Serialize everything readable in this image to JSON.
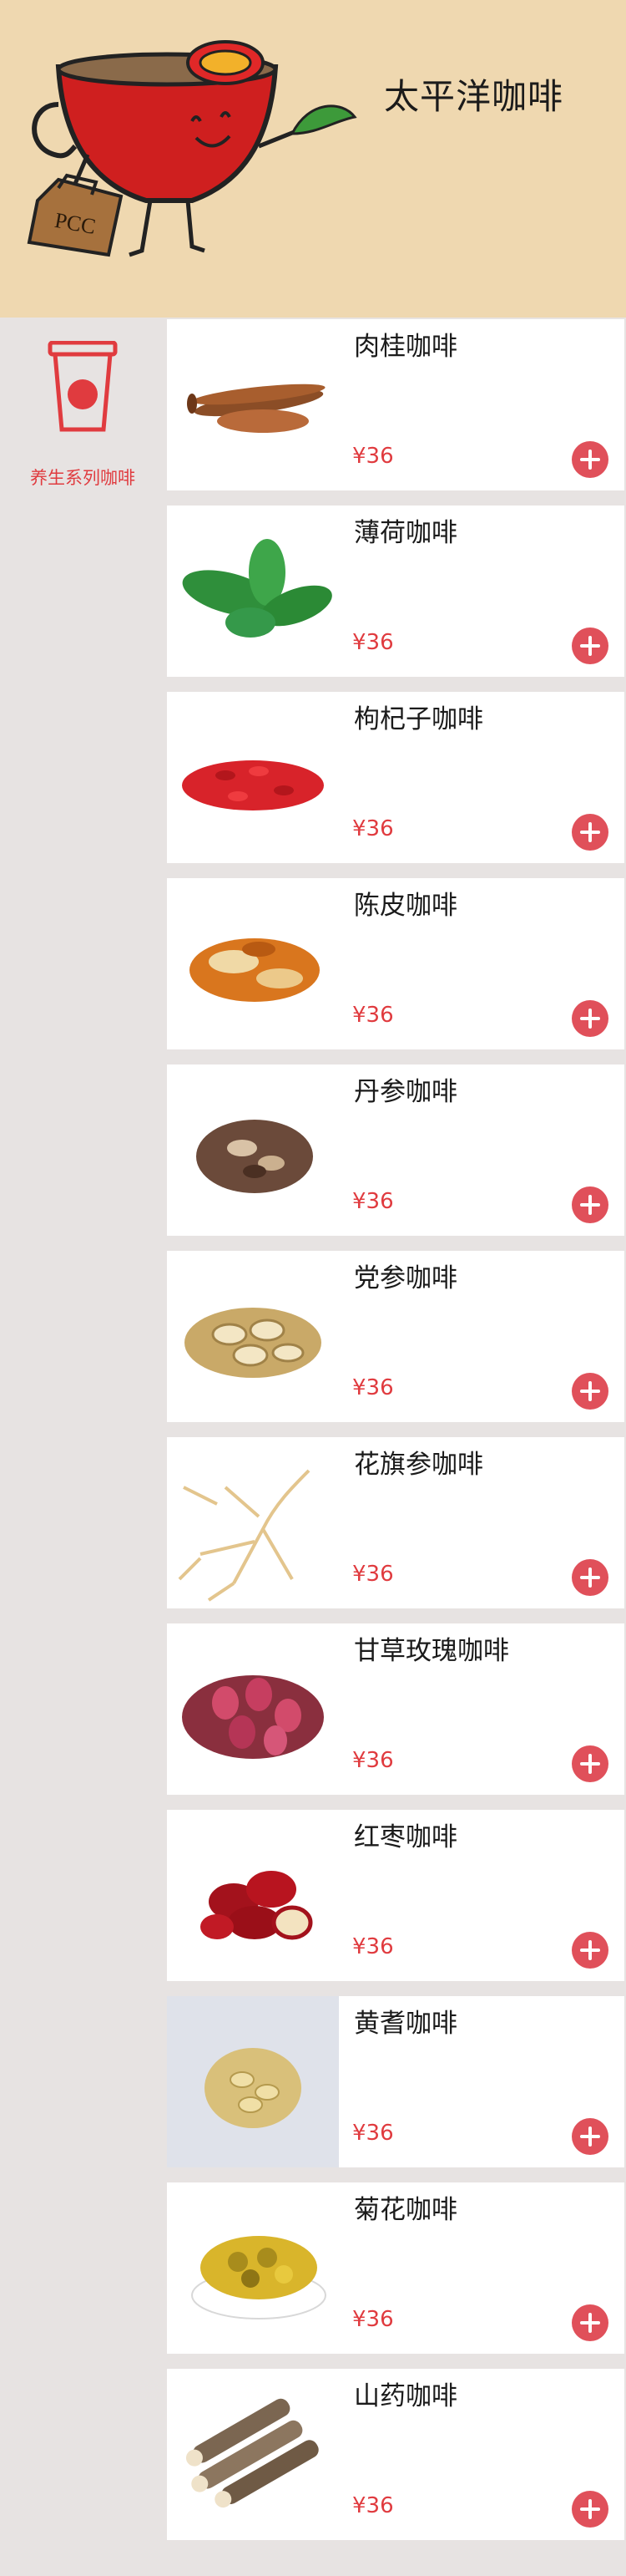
{
  "header": {
    "brand_title": "太平洋咖啡",
    "mascot_bag_text": "PCC"
  },
  "sidebar": {
    "category": {
      "label": "养生系列咖啡",
      "icon": "coffee-cup-icon",
      "color": "#e03b3f"
    }
  },
  "products": [
    {
      "name": "肉桂咖啡",
      "price": "¥36",
      "image": "cinnamon-image"
    },
    {
      "name": "薄荷咖啡",
      "price": "¥36",
      "image": "mint-image"
    },
    {
      "name": "枸杞子咖啡",
      "price": "¥36",
      "image": "goji-image"
    },
    {
      "name": "陈皮咖啡",
      "price": "¥36",
      "image": "orange-peel-image"
    },
    {
      "name": "丹参咖啡",
      "price": "¥36",
      "image": "danshen-image"
    },
    {
      "name": "党参咖啡",
      "price": "¥36",
      "image": "dangshen-image"
    },
    {
      "name": "花旗参咖啡",
      "price": "¥36",
      "image": "ginseng-image"
    },
    {
      "name": "甘草玫瑰咖啡",
      "price": "¥36",
      "image": "rose-bud-image"
    },
    {
      "name": "红枣咖啡",
      "price": "¥36",
      "image": "red-date-image"
    },
    {
      "name": "黄耆咖啡",
      "price": "¥36",
      "image": "astragalus-image"
    },
    {
      "name": "菊花咖啡",
      "price": "¥36",
      "image": "chrysanthemum-image"
    },
    {
      "name": "山药咖啡",
      "price": "¥36",
      "image": "yam-image"
    }
  ],
  "colors": {
    "header_bg": "#efd8b0",
    "page_bg": "#e7e3e2",
    "accent_red": "#e03b3f",
    "add_button": "#e0505a"
  }
}
